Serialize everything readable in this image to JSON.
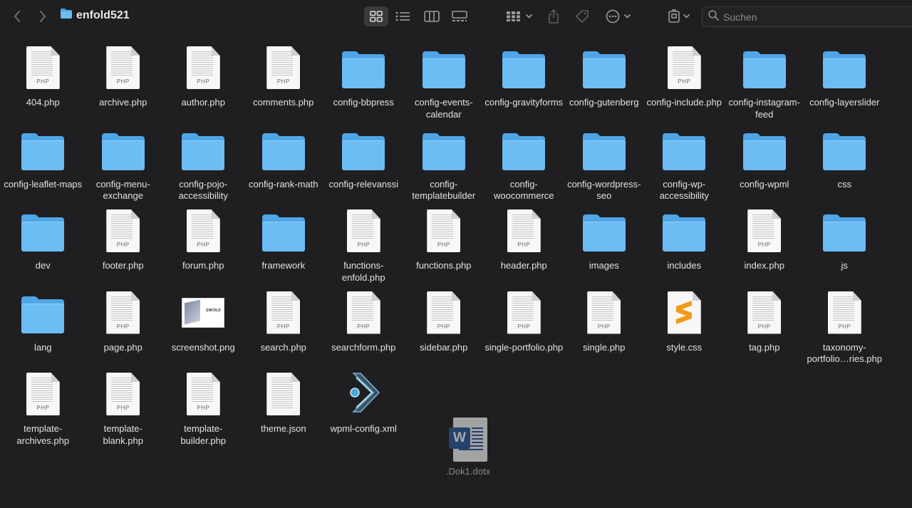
{
  "window": {
    "title": "enfold521",
    "search_placeholder": "Suchen"
  },
  "toolbar": {
    "nav": [
      "chevron-left-icon",
      "chevron-right-icon"
    ],
    "view_modes": [
      "icon-view-icon",
      "list-view-icon",
      "column-view-icon",
      "gallery-view-icon"
    ],
    "selected_view": "icon-view-icon",
    "actions": [
      "group-icon",
      "share-icon",
      "tag-icon",
      "more-icon",
      "delete-icon"
    ]
  },
  "items": [
    {
      "name": "404.php",
      "kind": "php"
    },
    {
      "name": "archive.php",
      "kind": "php"
    },
    {
      "name": "author.php",
      "kind": "php"
    },
    {
      "name": "comments.php",
      "kind": "php"
    },
    {
      "name": "config-bbpress",
      "kind": "folder"
    },
    {
      "name": "config-events-calendar",
      "kind": "folder"
    },
    {
      "name": "config-gravityforms",
      "kind": "folder"
    },
    {
      "name": "config-gutenberg",
      "kind": "folder"
    },
    {
      "name": "config-include.php",
      "kind": "php"
    },
    {
      "name": "config-instagram-feed",
      "kind": "folder"
    },
    {
      "name": "config-layerslider",
      "kind": "folder"
    },
    {
      "name": "config-leaflet-maps",
      "kind": "folder"
    },
    {
      "name": "config-menu-exchange",
      "kind": "folder"
    },
    {
      "name": "config-pojo-accessibility",
      "kind": "folder"
    },
    {
      "name": "config-rank-math",
      "kind": "folder"
    },
    {
      "name": "config-relevanssi",
      "kind": "folder"
    },
    {
      "name": "config-templatebuilder",
      "kind": "folder"
    },
    {
      "name": "config-woocommerce",
      "kind": "folder"
    },
    {
      "name": "config-wordpress-seo",
      "kind": "folder"
    },
    {
      "name": "config-wp-accessibility",
      "kind": "folder"
    },
    {
      "name": "config-wpml",
      "kind": "folder"
    },
    {
      "name": "css",
      "kind": "folder"
    },
    {
      "name": "dev",
      "kind": "folder"
    },
    {
      "name": "footer.php",
      "kind": "php"
    },
    {
      "name": "forum.php",
      "kind": "php"
    },
    {
      "name": "framework",
      "kind": "folder"
    },
    {
      "name": "functions-enfold.php",
      "kind": "php"
    },
    {
      "name": "functions.php",
      "kind": "php"
    },
    {
      "name": "header.php",
      "kind": "php"
    },
    {
      "name": "images",
      "kind": "folder"
    },
    {
      "name": "includes",
      "kind": "folder"
    },
    {
      "name": "index.php",
      "kind": "php"
    },
    {
      "name": "js",
      "kind": "folder"
    },
    {
      "name": "lang",
      "kind": "folder"
    },
    {
      "name": "page.php",
      "kind": "php"
    },
    {
      "name": "screenshot.png",
      "kind": "png"
    },
    {
      "name": "search.php",
      "kind": "php"
    },
    {
      "name": "searchform.php",
      "kind": "php"
    },
    {
      "name": "sidebar.php",
      "kind": "php"
    },
    {
      "name": "single-portfolio.php",
      "kind": "php"
    },
    {
      "name": "single.php",
      "kind": "php"
    },
    {
      "name": "style.css",
      "kind": "css"
    },
    {
      "name": "tag.php",
      "kind": "php"
    },
    {
      "name": "taxonomy-portfolio…ries.php",
      "kind": "php"
    },
    {
      "name": "template-archives.php",
      "kind": "php"
    },
    {
      "name": "template-blank.php",
      "kind": "php"
    },
    {
      "name": "template-builder.php",
      "kind": "php"
    },
    {
      "name": "theme.json",
      "kind": "json"
    },
    {
      "name": "wpml-config.xml",
      "kind": "xml"
    }
  ],
  "labels": {
    "php_badge": "PHP",
    "png_badge": "ENFOLD",
    "word_badge": "W"
  },
  "dragging_item": {
    "name": ".Dok1.dotx",
    "kind": "word"
  }
}
